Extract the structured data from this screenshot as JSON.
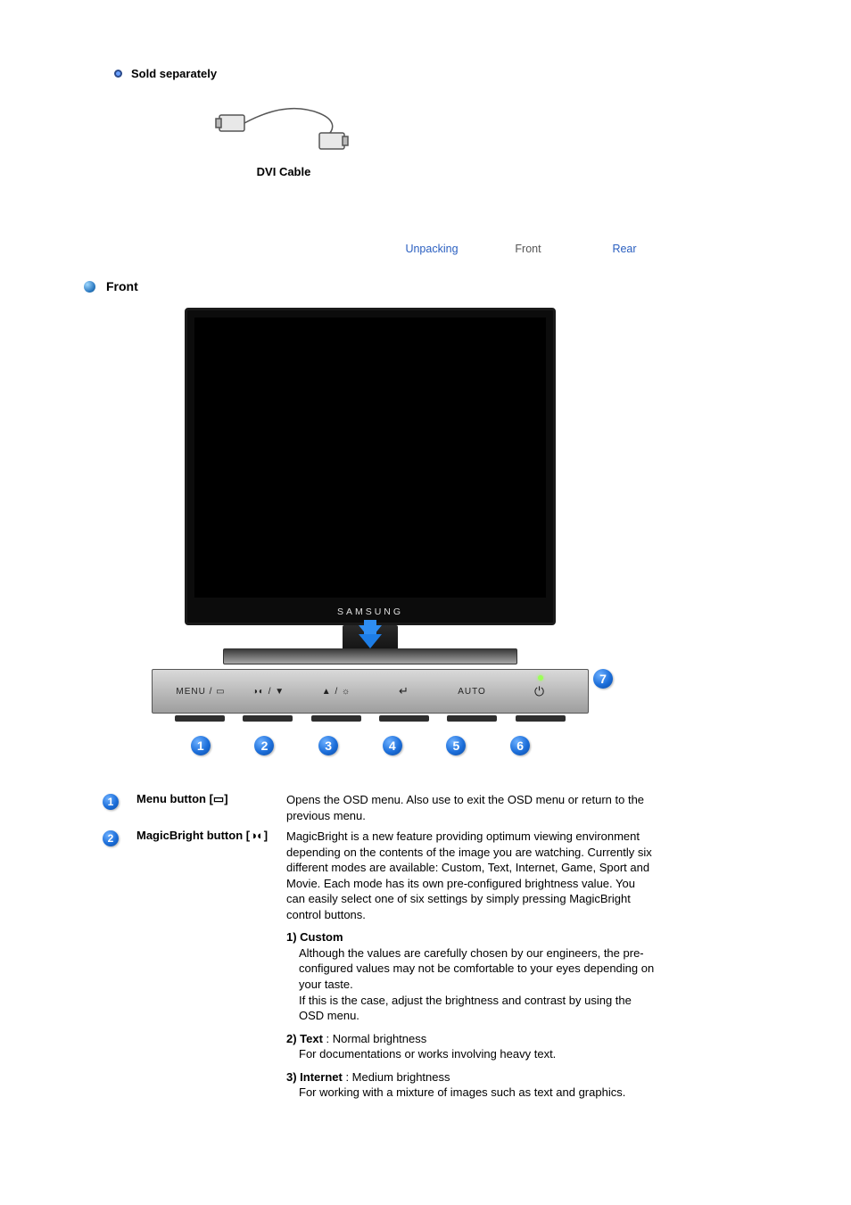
{
  "sold_separately": {
    "heading": "Sold separately",
    "item_label": "DVI Cable"
  },
  "nav": {
    "tabs": [
      {
        "label": "Unpacking",
        "active": false
      },
      {
        "label": "Front",
        "active": true
      },
      {
        "label": "Rear",
        "active": false
      }
    ]
  },
  "front": {
    "heading": "Front",
    "brand": "SAMSUNG",
    "panel_buttons": [
      {
        "label": "MENU / ▭",
        "name": "panel-btn-menu"
      },
      {
        "label": "◑◐ / ▼",
        "name": "panel-btn-magicbright"
      },
      {
        "label": "▲ / ☼",
        "name": "panel-btn-brightness"
      },
      {
        "label": "↵",
        "name": "panel-btn-enter"
      },
      {
        "label": "AUTO",
        "name": "panel-btn-auto"
      },
      {
        "label": "⏻",
        "name": "panel-btn-power"
      }
    ],
    "callout_numbers": [
      "1",
      "2",
      "3",
      "4",
      "5",
      "6"
    ],
    "callout_seven": "7"
  },
  "descriptions": [
    {
      "num": "1",
      "name": "Menu button [▭]",
      "text": "Opens the OSD menu. Also use to exit the OSD menu or return to the previous menu."
    },
    {
      "num": "2",
      "name": "MagicBright button [◑◐]",
      "text": "MagicBright is a new feature providing optimum viewing environment depending on the contents of the image you are watching. Currently six different modes are available: Custom, Text, Internet, Game, Sport and Movie. Each mode has its own pre-configured brightness value. You can easily select one of six settings by simply pressing MagicBright control buttons.",
      "subitems": [
        {
          "head": "1) Custom",
          "body": "Although the values are carefully chosen by our engineers, the pre-configured values may not be comfortable to your eyes depending on your taste.\nIf this is the case, adjust the brightness and contrast by using the OSD menu."
        },
        {
          "head": "2) Text",
          "tail": " : Normal brightness",
          "body": "For documentations or works involving heavy text."
        },
        {
          "head": "3) Internet",
          "tail": " : Medium brightness",
          "body": "For working with a mixture of images such as text and graphics."
        }
      ]
    }
  ]
}
